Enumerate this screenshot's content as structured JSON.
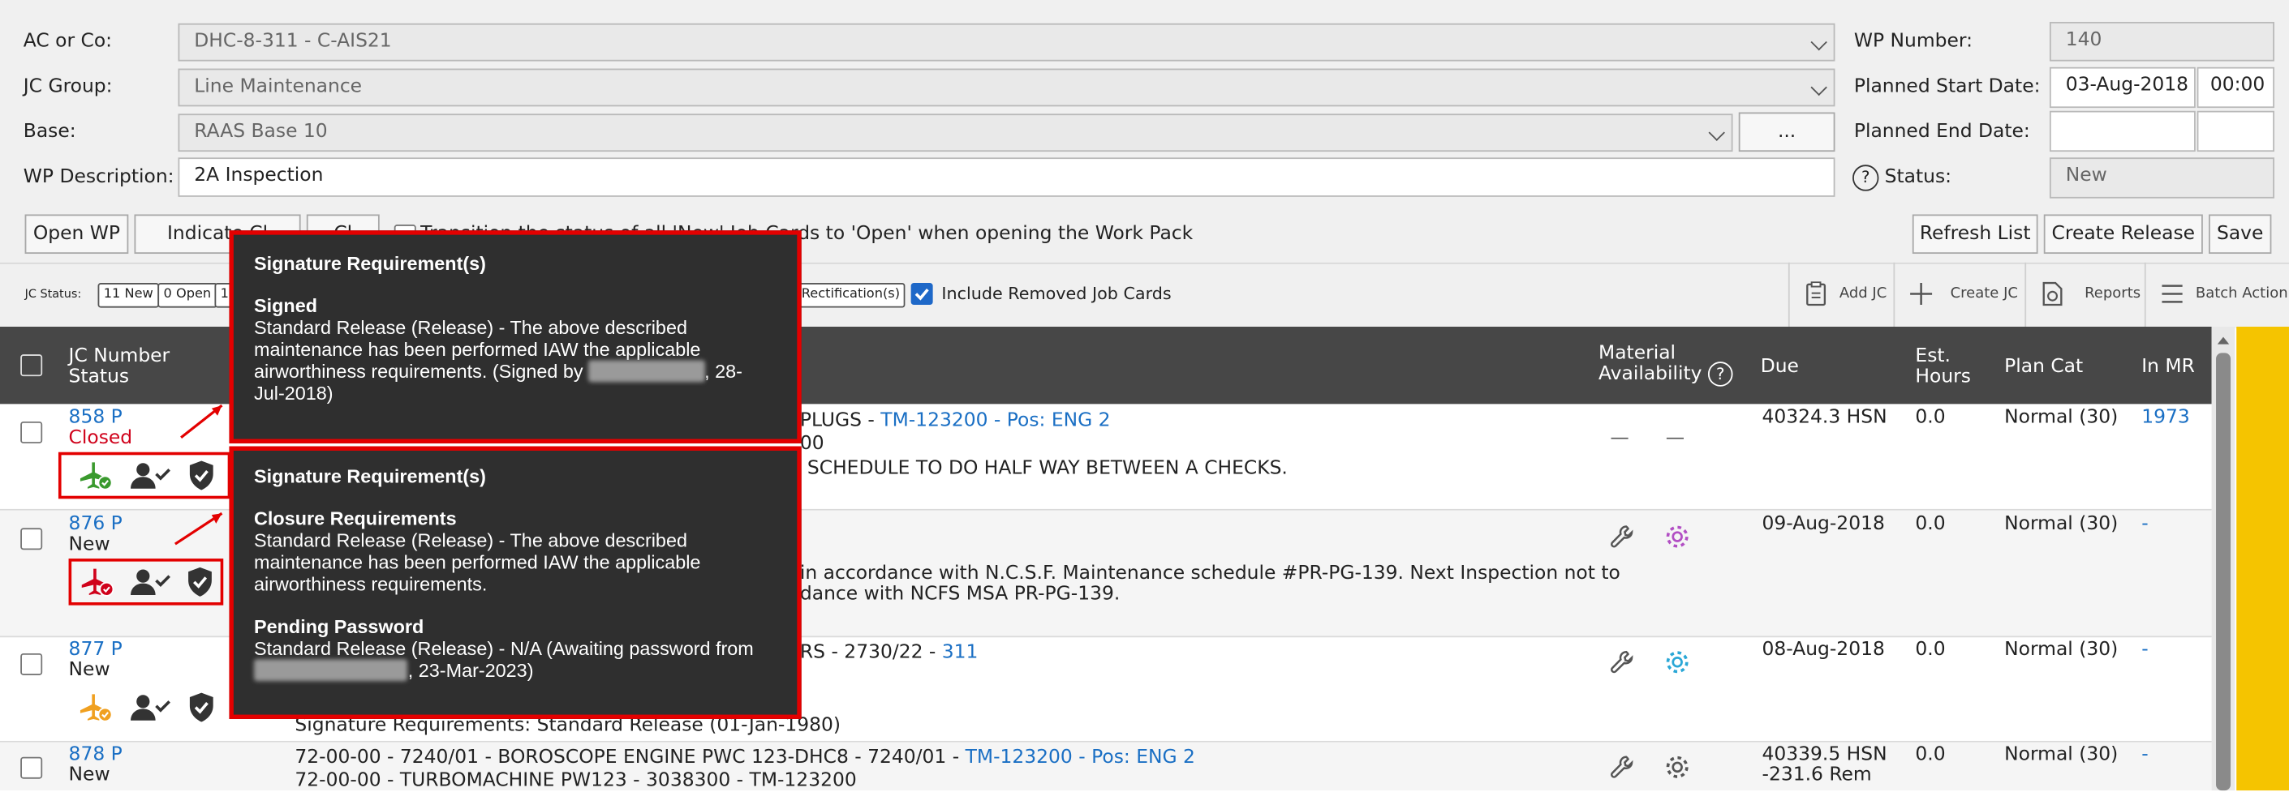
{
  "form": {
    "ac_label": "AC or Co:",
    "ac_value": "DHC-8-311 - C-AIS21",
    "jc_group_label": "JC Group:",
    "jc_group_value": "Line Maintenance",
    "base_label": "Base:",
    "base_value": "RAAS Base 10",
    "base_more": "...",
    "wp_desc_label": "WP Description:",
    "wp_desc_value": "2A Inspection",
    "wp_number_label": "WP Number:",
    "wp_number_value": "140",
    "planned_start_label": "Planned Start Date:",
    "planned_start_date": "03-Aug-2018",
    "planned_start_time": "00:00",
    "planned_end_label": "Planned End Date:",
    "status_label": "Status:",
    "status_value": "New",
    "help": "?"
  },
  "actions": {
    "open_wp": "Open WP",
    "indicate": "Indicate Cl",
    "close": "Cl",
    "transition_text": "Transition the status of all 'New' Job Cards to 'Open' when opening the Work Pack",
    "refresh": "Refresh List",
    "create_release": "Create Release",
    "save": "Save"
  },
  "status_bar": {
    "label": "JC Status:",
    "chips": [
      "11 New",
      "0 Open",
      "1"
    ],
    "rect_chip": "Rectification(s)",
    "include_removed": "Include Removed Job Cards"
  },
  "toolbar": {
    "add_jc": "Add JC",
    "create_jc": "Create JC",
    "reports": "Reports",
    "batch": "Batch Action"
  },
  "table": {
    "headers": {
      "jc_number": "JC Number",
      "status": "Status",
      "material": "Material",
      "availability": "Availability",
      "due": "Due",
      "est": "Est.",
      "hours": "Hours",
      "plan_cat": "Plan Cat",
      "in_mr": "In MR"
    },
    "rows": [
      {
        "num": "858 P",
        "status": "Closed",
        "line1a": "PLUGS - ",
        "line1b": "TM-123200 - Pos: ENG 2",
        "line2": "00",
        "line3": "SCHEDULE TO DO HALF WAY BETWEEN A CHECKS.",
        "mat1": "—",
        "mat2": "—",
        "due": "40324.3 HSN",
        "est": "0.0",
        "plan": "Normal (30)",
        "mr": "1973"
      },
      {
        "num": "876 P",
        "status": "New",
        "line1": "in accordance with N.C.S.F. Maintenance schedule #PR-PG-139. Next Inspection not to",
        "line2": "dance with NCFS MSA PR-PG-139.",
        "due": "09-Aug-2018",
        "est": "0.0",
        "plan": "Normal (30)",
        "mr": "-"
      },
      {
        "num": "877 P",
        "status": "New",
        "line1a": "RS - 2730/22 - ",
        "line1b": "311",
        "line2": "Signature Requirements: Standard Release (01-Jan-1980)",
        "due": "08-Aug-2018",
        "est": "0.0",
        "plan": "Normal (30)",
        "mr": "-"
      },
      {
        "num": "878 P",
        "status": "New",
        "line1a": "72-00-00 - 7240/01 - BOROSCOPE ENGINE PWC 123-DHC8 - 7240/01 - ",
        "line1b": "TM-123200 - Pos: ENG 2",
        "line2": "72-00-00 - TURBOMACHINE PW123 - 3038300 - TM-123200",
        "due": "40339.5 HSN",
        "due2": "-231.6 Rem",
        "est": "0.0",
        "plan": "Normal (30)",
        "mr": "-"
      }
    ]
  },
  "tooltip1": {
    "title": "Signature Requirement(s)",
    "sub": "Signed",
    "body1": "Standard Release (Release) - The above described",
    "body2": "maintenance has been performed IAW the applicable",
    "body3a": "airworthiness requirements. (Signed by ",
    "body3b": ", 28-",
    "body4": "Jul-2018)"
  },
  "tooltip2": {
    "title": "Signature Requirement(s)",
    "sub1": "Closure Requirements",
    "b1": "Standard Release (Release) - The above described",
    "b2": "maintenance has been performed IAW the applicable",
    "b3": "airworthiness requirements.",
    "sub2": "Pending Password",
    "p1": "Standard Release (Release) - N/A (Awaiting password from",
    "p2": ", 23-Mar-2023)"
  },
  "colors": {
    "green": "#3a9a2e",
    "red": "#d0021b",
    "orange": "#f0a020",
    "link": "#1a6fc4",
    "header": "#474747",
    "gear_purple": "#b24fc4",
    "gear_blue": "#2aa7d6"
  }
}
